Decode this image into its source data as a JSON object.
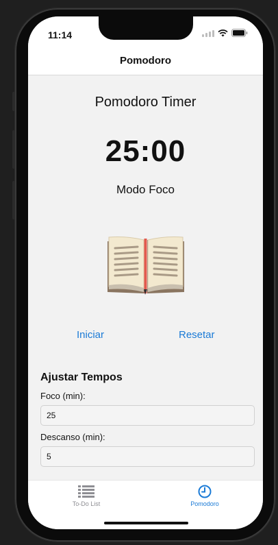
{
  "status": {
    "time": "11:14"
  },
  "navbar": {
    "title": "Pomodoro"
  },
  "main": {
    "title": "Pomodoro Timer",
    "timer": "25:00",
    "mode": "Modo Foco",
    "start_label": "Iniciar",
    "reset_label": "Resetar"
  },
  "settings": {
    "section_title": "Ajustar Tempos",
    "focus_label": "Foco (min):",
    "focus_value": "25",
    "break_label": "Descanso (min):",
    "break_value": "5"
  },
  "tabs": [
    {
      "label": "To-Do List",
      "icon": "list-icon",
      "active": false
    },
    {
      "label": "Pomodoro",
      "icon": "clock-icon",
      "active": true
    }
  ],
  "colors": {
    "accent": "#1a7ad6",
    "inactive_tab": "#8e8e93"
  }
}
